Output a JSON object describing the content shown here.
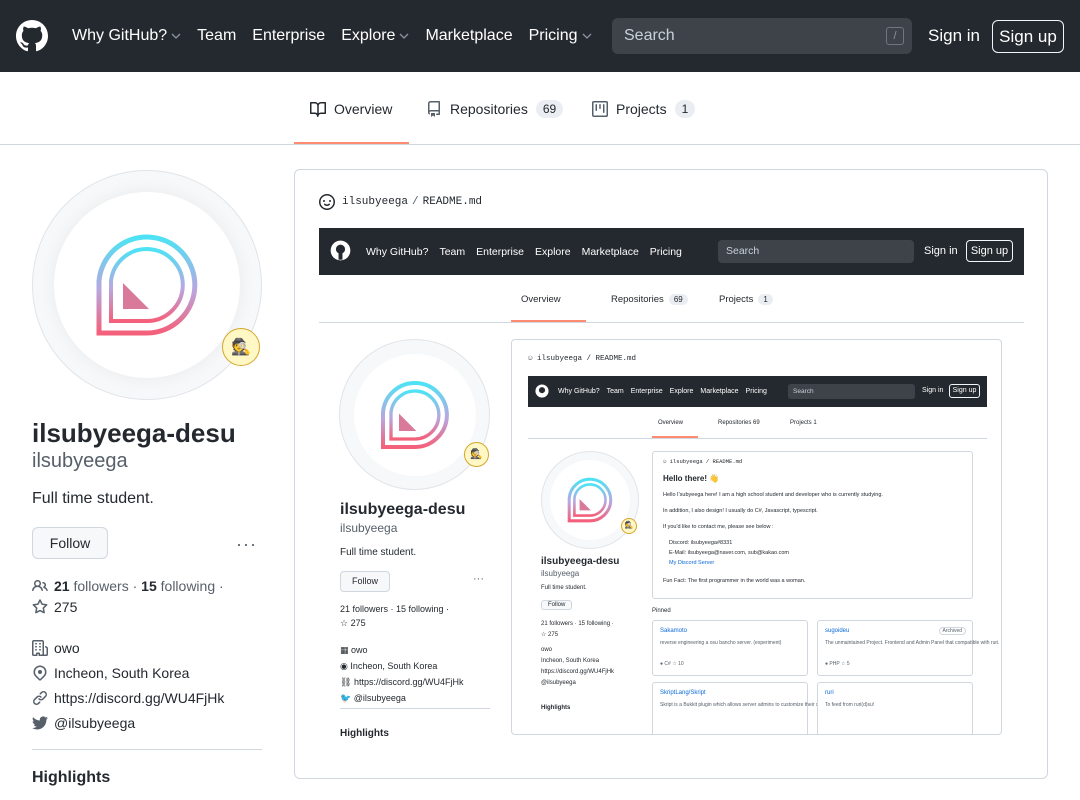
{
  "header": {
    "nav": [
      {
        "label": "Why GitHub?",
        "dropdown": true
      },
      {
        "label": "Team",
        "dropdown": false
      },
      {
        "label": "Enterprise",
        "dropdown": false
      },
      {
        "label": "Explore",
        "dropdown": true
      },
      {
        "label": "Marketplace",
        "dropdown": false
      },
      {
        "label": "Pricing",
        "dropdown": true
      }
    ],
    "search_placeholder": "Search",
    "search_shortcut": "/",
    "sign_in": "Sign in",
    "sign_up": "Sign up"
  },
  "tabs": [
    {
      "label": "Overview",
      "icon": "book-icon",
      "count": null,
      "active": true
    },
    {
      "label": "Repositories",
      "icon": "repo-icon",
      "count": "69",
      "active": false
    },
    {
      "label": "Projects",
      "icon": "project-icon",
      "count": "1",
      "active": false
    }
  ],
  "profile": {
    "full_name": "ilsubyeega-desu",
    "login": "ilsubyeega",
    "bio": "Full time student.",
    "follow_label": "Follow",
    "more": "···",
    "followers_count": "21",
    "followers_label": "followers",
    "following_count": "15",
    "following_label": "following",
    "dot": "·",
    "stars": "275",
    "company": "owo",
    "location": "Incheon, South Korea",
    "website": "https://discord.gg/WU4FjHk",
    "twitter": "@ilsubyeega",
    "highlights": "Highlights",
    "status_emoji": "🕵"
  },
  "readme": {
    "owner": "ilsubyeega",
    "sep": "/",
    "file": "README.md"
  },
  "nested": {
    "nav": [
      "Why GitHub?",
      "Team",
      "Enterprise",
      "Explore",
      "Marketplace",
      "Pricing"
    ],
    "search": "Search",
    "slash": "/",
    "sign_in": "Sign in",
    "sign_up": "Sign up",
    "tab_overview": "Overview",
    "tab_repos": "Repositories",
    "repos_count": "69",
    "tab_projects": "Projects",
    "projects_count": "1",
    "name": "ilsubyeega-desu",
    "login": "ilsubyeega",
    "bio": "Full time student.",
    "follow": "Follow",
    "follow_line": "21 followers · 15 following ·",
    "stars": "275",
    "company": "owo",
    "location": "Incheon, South Korea",
    "website": "https://discord.gg/WU4FjHk",
    "twitter": "@ilsubyeega",
    "highlights": "Highlights",
    "readme_owner": "ilsubyeega",
    "readme_file": "README.md"
  },
  "nested2": {
    "hello": "Hello there! 👋",
    "p1": "Hello I'subyeega here! I am a high school student and developer who is currently studying.",
    "p2": "In addition, I also design! I usually do C#, Javascript, typescript.",
    "p3": "If you'd like to contact me, please see below :",
    "discord": "Discord: ilsubyeega#8331",
    "email": "E-Mail: ilsubyeega@naver.com, sub@kakao.com",
    "server": "My Discord Server",
    "funfact": "Fun Fact: The first programmer in the world was a woman.",
    "pinned": "Pinned",
    "follow_line": "21 followers · 15 following ·",
    "pins": [
      {
        "name": "Sakamoto",
        "desc": "reverse engineering a osu bancho server. (experiment)",
        "lang": "C#",
        "stars": "10",
        "archived": ""
      },
      {
        "name": "sugoideu",
        "desc": "The unmaintained Project. Frontend and Admin Panel that compatible with ruri.",
        "lang": "PHP",
        "stars": "5",
        "archived": "Archived"
      },
      {
        "name": "SkriptLang/Skript",
        "desc": "Skript is a Bukkit plugin which allows server admins to customize their server easily, but without the hassle of",
        "lang": "",
        "stars": "",
        "archived": ""
      },
      {
        "name": "ruri",
        "desc": "To feed from ruri(d)su!",
        "lang": "",
        "stars": "",
        "archived": ""
      }
    ]
  }
}
